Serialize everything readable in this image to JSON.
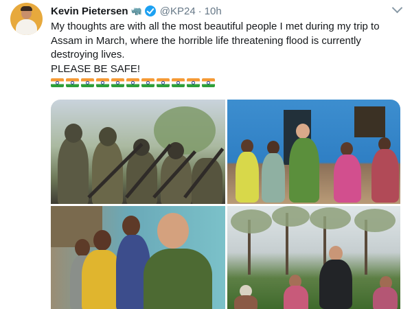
{
  "tweet": {
    "author_name": "Kevin Pietersen",
    "sport_emoji": "🦏",
    "handle": "@KP24",
    "separator": "·",
    "time": "10h",
    "text_lines": [
      "My thoughts are with all the most beautiful people I met during my trip to Assam in March, where the horrible life threatening flood is currently destroying lives.",
      "PLEASE BE SAFE!"
    ],
    "flag_count": 11,
    "flag_icon": "india-flag-icon",
    "photos": [
      {
        "subject": "armed-guards-photo"
      },
      {
        "subject": "villagers-group-photo"
      },
      {
        "subject": "children-portrait-photo"
      },
      {
        "subject": "tea-garden-photo"
      }
    ]
  },
  "colors": {
    "verified_blue": "#1da1f2",
    "secondary_text": "#657786",
    "primary_text": "#14171a"
  }
}
